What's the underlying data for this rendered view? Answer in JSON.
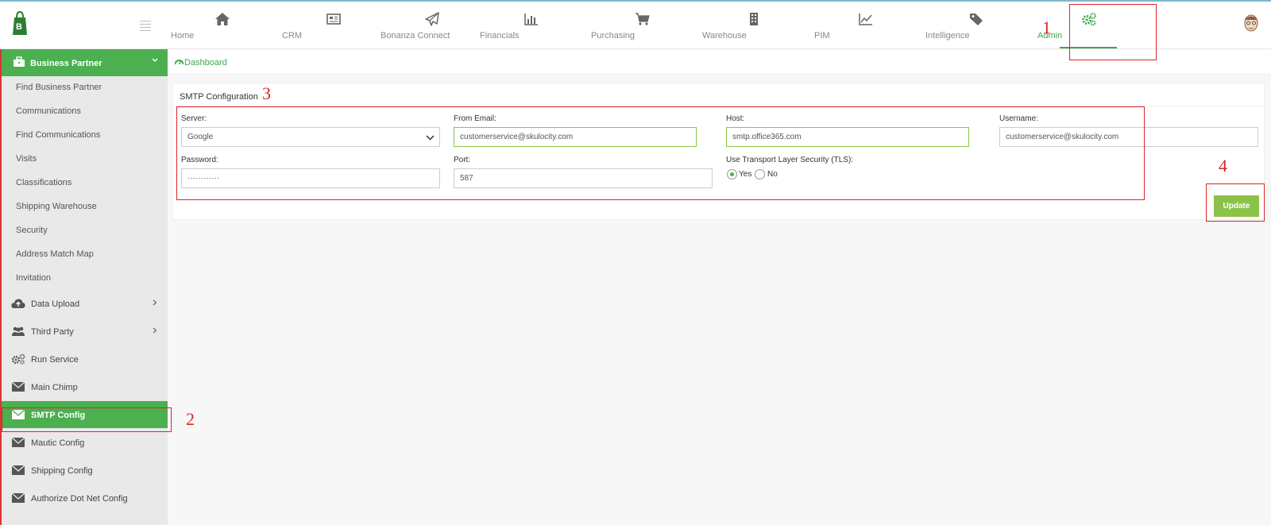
{
  "nav": {
    "items": [
      {
        "label": "Home",
        "icon": "home-icon"
      },
      {
        "label": "CRM",
        "icon": "newspaper-icon"
      },
      {
        "label": "Bonanza Connect",
        "icon": "paper-plane-icon"
      },
      {
        "label": "Financials",
        "icon": "bar-chart-icon"
      },
      {
        "label": "Purchasing",
        "icon": "cart-icon"
      },
      {
        "label": "Warehouse",
        "icon": "building-icon"
      },
      {
        "label": "PIM",
        "icon": "line-chart-icon"
      },
      {
        "label": "Intelligence",
        "icon": "tags-icon"
      },
      {
        "label": "Admin",
        "icon": "gears-icon"
      }
    ],
    "active": "Admin"
  },
  "sidebar": {
    "header": "Business Partner",
    "subitems": [
      "Find Business Partner",
      "Communications",
      "Find Communications",
      "Visits",
      "Classifications",
      "Shipping Warehouse",
      "Security",
      "Address Match Map",
      "Invitation"
    ],
    "items": [
      {
        "label": "Data Upload",
        "icon": "cloud-upload-icon"
      },
      {
        "label": "Third Party",
        "icon": "users-icon"
      },
      {
        "label": "Run Service",
        "icon": "gears-icon"
      },
      {
        "label": "Main Chimp",
        "icon": "envelope-icon"
      },
      {
        "label": "SMTP Config",
        "icon": "envelope-icon"
      },
      {
        "label": "Mautic Config",
        "icon": "envelope-icon"
      },
      {
        "label": "Shipping Config",
        "icon": "envelope-icon"
      },
      {
        "label": "Authorize Dot Net Config",
        "icon": "envelope-icon"
      }
    ]
  },
  "breadcrumb": {
    "label": "Dashboard"
  },
  "form": {
    "title": "SMTP Configuration",
    "server_label": "Server:",
    "server_value": "Google",
    "from_email_label": "From Email:",
    "from_email_value": "customerservice@skulocity.com",
    "host_label": "Host:",
    "host_value": "smtp.office365.com",
    "username_label": "Username:",
    "username_value": "customerservice@skulocity.com",
    "password_label": "Password:",
    "password_value": "············",
    "port_label": "Port:",
    "port_value": "587",
    "tls_label": "Use Transport Layer Security (TLS):",
    "tls_yes": "Yes",
    "tls_no": "No",
    "tls_selected": "Yes",
    "update_label": "Update"
  },
  "annotations": {
    "n1": "1",
    "n2": "2",
    "n3": "3",
    "n4": "4"
  },
  "colors": {
    "accent": "#4caf50",
    "button": "#8bc34a",
    "annotation": "#d9262a"
  }
}
